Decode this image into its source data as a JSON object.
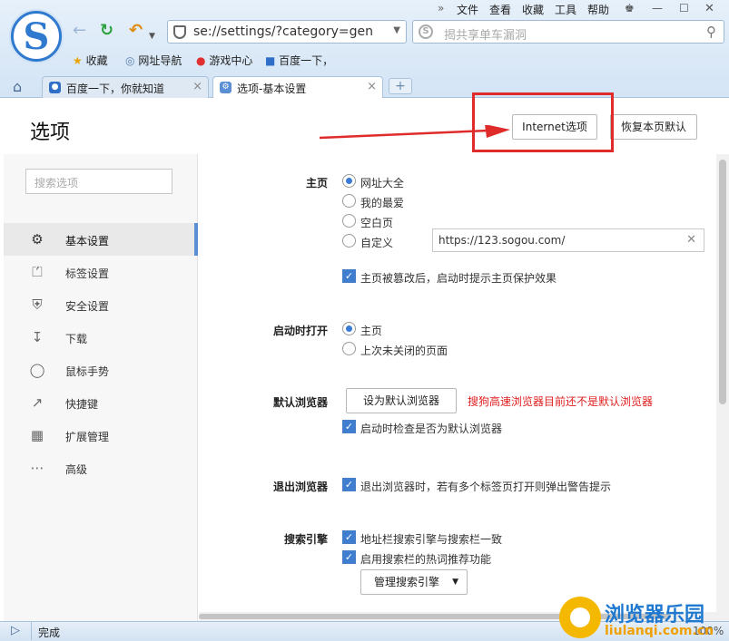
{
  "menu": [
    "文件",
    "查看",
    "收藏",
    "工具",
    "帮助"
  ],
  "address": {
    "url": "se://settings/?category=gen"
  },
  "search": {
    "placeholder": "揭共享单车漏洞"
  },
  "favorites": [
    "收藏",
    "网址导航",
    "游戏中心",
    "百度一下，"
  ],
  "tabs": [
    {
      "title": "百度一下，你就知道"
    },
    {
      "title": "选项-基本设置"
    }
  ],
  "page": {
    "title": "选项",
    "internet_button": "Internet选项",
    "restore_button": "恢复本页默认"
  },
  "sidebar": {
    "search_placeholder": "搜索选项",
    "items": [
      {
        "label": "基本设置",
        "icon": "gear-icon"
      },
      {
        "label": "标签设置",
        "icon": "tab-icon"
      },
      {
        "label": "安全设置",
        "icon": "shield-icon"
      },
      {
        "label": "下载",
        "icon": "download-icon"
      },
      {
        "label": "鼠标手势",
        "icon": "mouse-icon"
      },
      {
        "label": "快捷键",
        "icon": "shortcut-icon"
      },
      {
        "label": "扩展管理",
        "icon": "extensions-icon"
      },
      {
        "label": "高级",
        "icon": "more-icon"
      }
    ]
  },
  "homepage": {
    "label": "主页",
    "options": [
      "网址大全",
      "我的最爱",
      "空白页",
      "自定义"
    ],
    "custom_url": "https://123.sogou.com/",
    "protect": "主页被篡改后，启动时提示主页保护效果"
  },
  "startup": {
    "label": "启动时打开",
    "options": [
      "主页",
      "上次未关闭的页面"
    ]
  },
  "default_browser": {
    "label": "默认浏览器",
    "button": "设为默认浏览器",
    "warning": "搜狗高速浏览器目前还不是默认浏览器",
    "check": "启动时检查是否为默认浏览器"
  },
  "exit": {
    "label": "退出浏览器",
    "check": "退出浏览器时，若有多个标签页打开则弹出警告提示"
  },
  "search_engine": {
    "label": "搜索引擎",
    "checks": [
      "地址栏搜索引擎与搜索栏一致",
      "启用搜索栏的热词推荐功能"
    ],
    "manage_button": "管理搜索引擎"
  },
  "status": {
    "text": "完成",
    "zoom": "100%"
  },
  "watermark": {
    "title": "浏览器乐园",
    "url": "liulanqi.com.cn"
  },
  "colors": {
    "accent": "#3a7bd5",
    "highlight": "#e02b2b"
  }
}
